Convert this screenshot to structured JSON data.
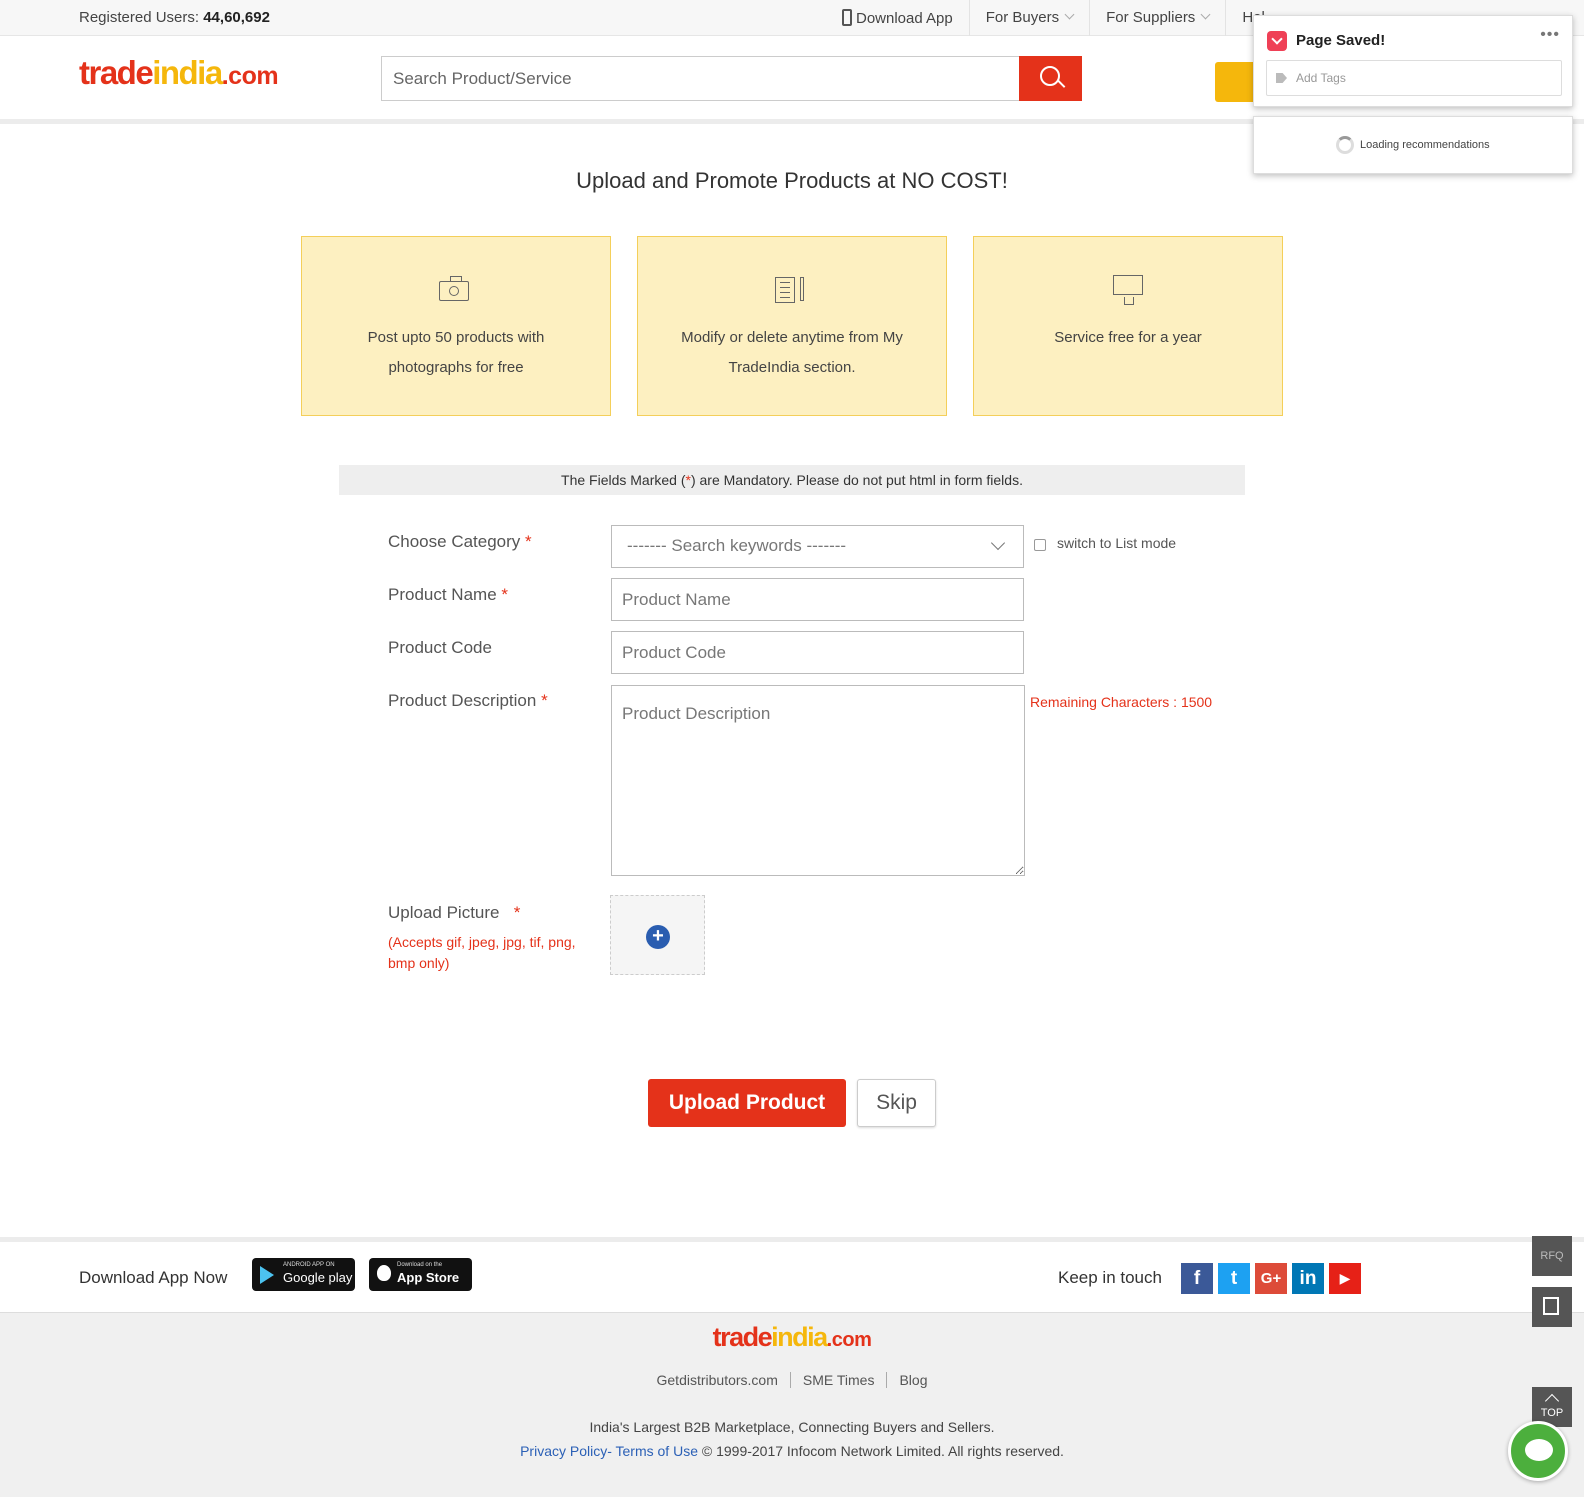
{
  "topbar": {
    "registered_label": "Registered Users:",
    "registered_count": "44,60,692",
    "nav": [
      "Download App",
      "For Buyers",
      "For Suppliers",
      "Hel"
    ]
  },
  "header": {
    "logo": [
      "trade",
      "india",
      ".com"
    ],
    "search_placeholder": "Search Product/Service"
  },
  "pocket": {
    "title": "Page Saved!",
    "tags_placeholder": "Add Tags",
    "loading": "Loading recommendations"
  },
  "hero": {
    "title": "Upload and Promote Products at NO COST!",
    "cards": [
      {
        "icon": "camera-icon",
        "text": "Post upto 50 products with photographs for free"
      },
      {
        "icon": "document-edit-icon",
        "text": "Modify or delete anytime from My TradeIndia section."
      },
      {
        "icon": "monitor-icon",
        "text": "Service free for a year"
      }
    ]
  },
  "note": {
    "before": "The Fields Marked (",
    "star": "*",
    "after": ") are Mandatory. Please do not put html in form fields."
  },
  "form": {
    "category_label": "Choose Category",
    "category_placeholder": "------- Search keywords -------",
    "list_mode_label": "switch to List mode",
    "product_name_label": "Product Name",
    "product_name_placeholder": "Product Name",
    "product_code_label": "Product Code",
    "product_code_placeholder": "Product Code",
    "description_label": "Product Description",
    "description_placeholder": "Product Description",
    "remaining": "Remaining Characters : 1500",
    "upload_label": "Upload Picture",
    "accepts": "(Accepts gif, jpeg, jpg, tif, png, bmp only)",
    "required_mark": "*",
    "upload_button": "Upload Product",
    "skip_button": "Skip"
  },
  "footer": {
    "download_app": "Download App Now",
    "google_small": "ANDROID APP ON",
    "google_large": "Google play",
    "apple_small": "Download on the",
    "apple_large": "App Store",
    "keep_in_touch": "Keep in touch",
    "social": [
      "f",
      "t",
      "G+",
      "in",
      "▶"
    ],
    "links": [
      "Getdistributors.com",
      "SME Times",
      "Blog"
    ],
    "tagline": "India's Largest B2B Marketplace, Connecting Buyers and Sellers.",
    "privacy": "Privacy Policy",
    "terms": "- Terms of Use",
    "copyright": " © 1999-2017 Infocom Network Limited. All rights reserved."
  },
  "floating": {
    "rfq": "RFQ",
    "top": "TOP"
  },
  "colors": {
    "brand_red": "#e4321a",
    "brand_yellow": "#f5b70c",
    "card_bg": "#fdf0c1",
    "link_blue": "#2b60b6",
    "chat_green": "#4caf3d"
  }
}
